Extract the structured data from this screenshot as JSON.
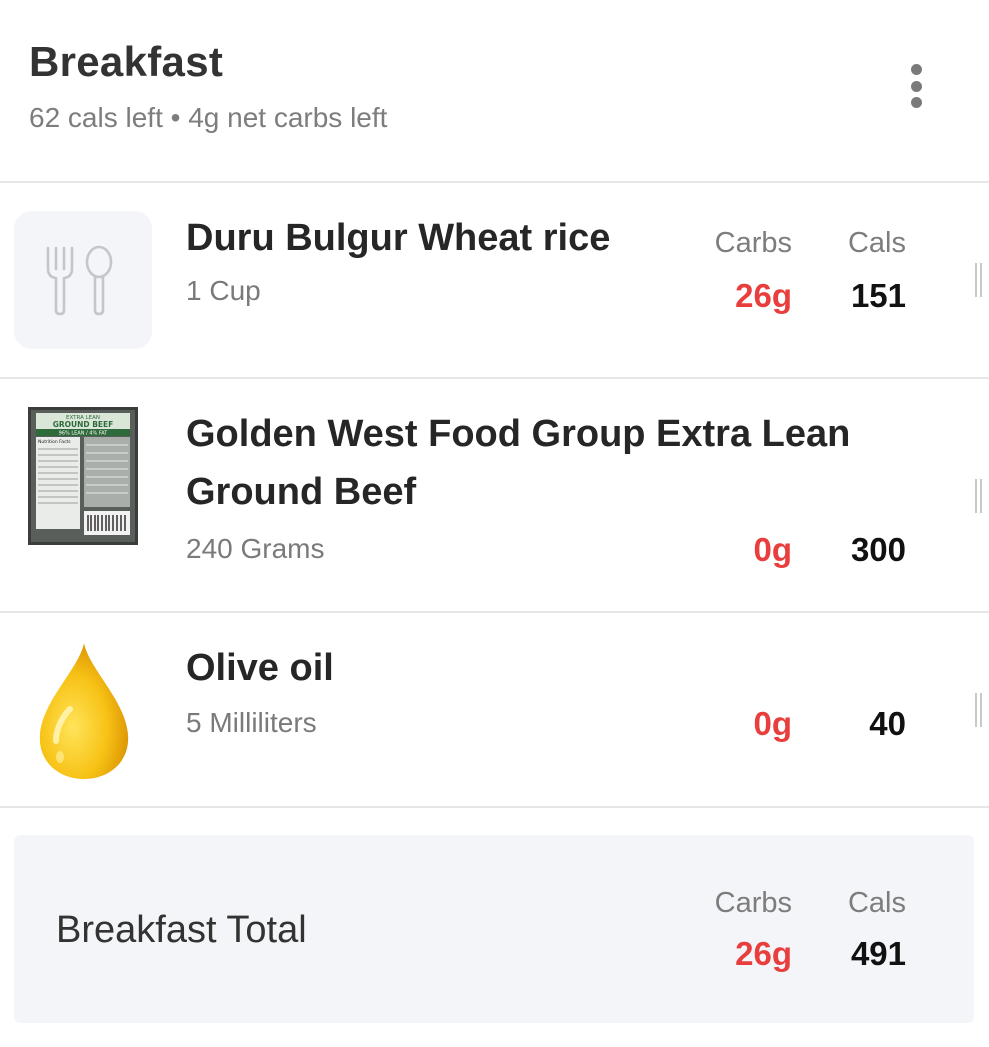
{
  "meal": {
    "title": "Breakfast",
    "subtitle": "62 cals left • 4g net carbs left"
  },
  "columns": {
    "carbs_label": "Carbs",
    "cals_label": "Cals"
  },
  "items": [
    {
      "name": "Duru Bulgur Wheat rice",
      "serving": "1 Cup",
      "carbs": "26g",
      "cals": "151",
      "thumbnail": "fork-spoon-icon"
    },
    {
      "name": "Golden West Food Group Extra Lean Ground Beef",
      "serving": "240 Grams",
      "carbs": "0g",
      "cals": "300",
      "thumbnail": "ground-beef-package-image",
      "package_text": {
        "line1": "EXTRA LEAN",
        "line2": "GROUND BEEF",
        "line3": "96% LEAN / 4% FAT",
        "line4": "Nutrition Facts"
      }
    },
    {
      "name": "Olive oil",
      "serving": "5 Milliliters",
      "carbs": "0g",
      "cals": "40",
      "thumbnail": "oil-drop-icon"
    }
  ],
  "total": {
    "label": "Breakfast Total",
    "carbs": "26g",
    "cals": "491"
  },
  "colors": {
    "carbs": "#e83e3e",
    "cals": "#111111",
    "muted": "#7d7d7d",
    "total_bg": "#f4f5f8"
  }
}
